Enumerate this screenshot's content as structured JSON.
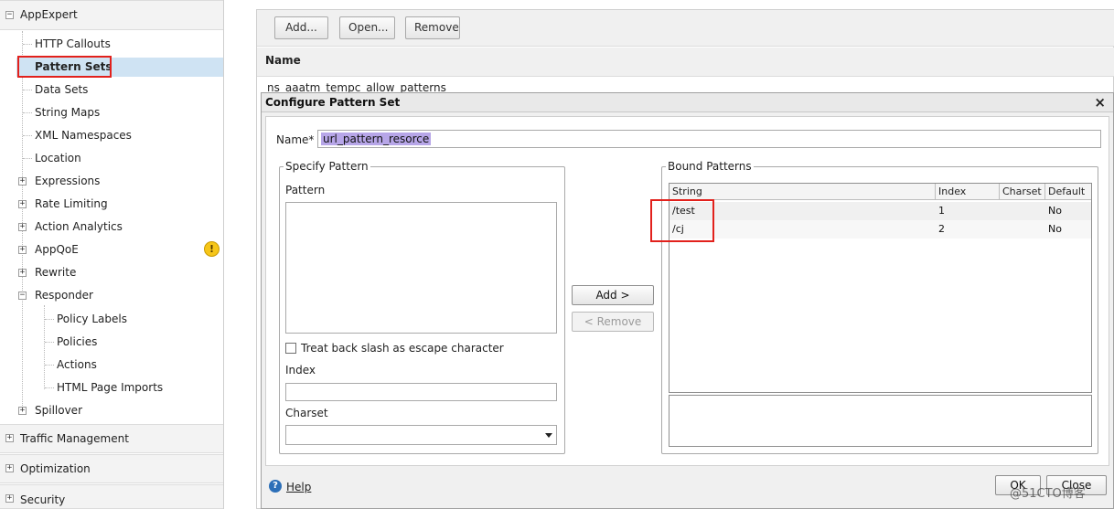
{
  "nav": {
    "sections": [
      {
        "label": "AppExpert",
        "expanded": true
      },
      {
        "label": "Traffic Management",
        "expanded": false
      },
      {
        "label": "Optimization",
        "expanded": false
      },
      {
        "label": "Security",
        "expanded": false
      }
    ],
    "items": [
      {
        "label": "HTTP Callouts"
      },
      {
        "label": "Pattern Sets",
        "selected": true
      },
      {
        "label": "Data Sets"
      },
      {
        "label": "String Maps"
      },
      {
        "label": "XML Namespaces"
      },
      {
        "label": "Location"
      },
      {
        "label": "Expressions",
        "expandable": true
      },
      {
        "label": "Rate Limiting",
        "expandable": true
      },
      {
        "label": "Action Analytics",
        "expandable": true
      },
      {
        "label": "AppQoE",
        "expandable": true,
        "warning": true
      },
      {
        "label": "Rewrite",
        "expandable": true
      },
      {
        "label": "Responder",
        "expandable": true,
        "expanded": true
      },
      {
        "label": "Spillover",
        "expandable": true
      }
    ],
    "responder_children": [
      {
        "label": "Policy Labels"
      },
      {
        "label": "Policies"
      },
      {
        "label": "Actions"
      },
      {
        "label": "HTML Page Imports"
      }
    ],
    "warning_glyph": "!"
  },
  "main": {
    "toolbar": {
      "add": "Add...",
      "open": "Open...",
      "remove": "Remove"
    },
    "column_name": "Name",
    "rows": [
      "ns_aaatm_tempc_allow_patterns"
    ]
  },
  "dialog": {
    "title": "Configure Pattern Set",
    "close_glyph": "×",
    "name_label": "Name*",
    "name_value": "url_pattern_resorce",
    "specify": {
      "legend": "Specify Pattern",
      "pattern_label": "Pattern",
      "checkbox_label": "Treat back slash as escape character",
      "index_label": "Index",
      "charset_label": "Charset"
    },
    "add_button": "Add >",
    "remove_button": "< Remove",
    "bound": {
      "legend": "Bound Patterns",
      "columns": [
        "String",
        "Index",
        "Charset",
        "Default"
      ],
      "rows": [
        {
          "string": "/test",
          "index": "1",
          "charset": "",
          "default": "No"
        },
        {
          "string": "/cj",
          "index": "2",
          "charset": "",
          "default": "No"
        }
      ]
    },
    "help": "Help",
    "ok": "OK",
    "close": "Close"
  },
  "watermark": "@51CTO博客",
  "colors": {
    "selection": "#cfe3f3",
    "highlight_box": "#e2211c",
    "warning": "#f6c619"
  }
}
